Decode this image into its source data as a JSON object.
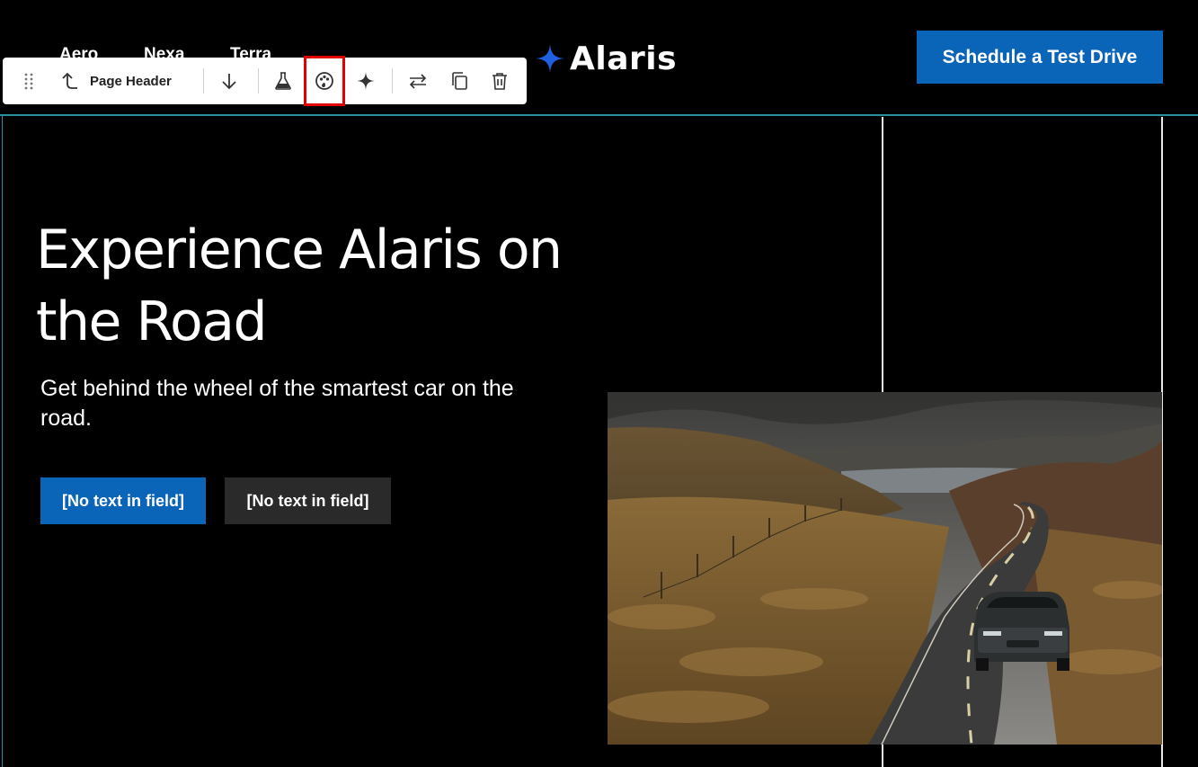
{
  "nav": {
    "items": [
      "Aero",
      "Nexa",
      "Terra"
    ]
  },
  "brand": {
    "name": "Alaris",
    "accent": "#1f5fe0"
  },
  "cta": {
    "label": "Schedule a Test Drive",
    "color": "#0a64b8"
  },
  "toolbar": {
    "label": "Page Header",
    "icons": [
      "drag-handle-icon",
      "select-parent-icon",
      "move-down-icon",
      "test-flask-icon",
      "style-palette-icon",
      "ai-sparkle-icon",
      "swap-icon",
      "duplicate-icon",
      "delete-icon"
    ]
  },
  "hero": {
    "title": "Experience Alaris on the Road",
    "subtitle": "Get behind the wheel of the smartest car on the road.",
    "primary_button": "[No text in field]",
    "secondary_button": "[No text in field]"
  },
  "colors": {
    "header_divider": "#2d8e9b",
    "highlight": "#e00000"
  }
}
